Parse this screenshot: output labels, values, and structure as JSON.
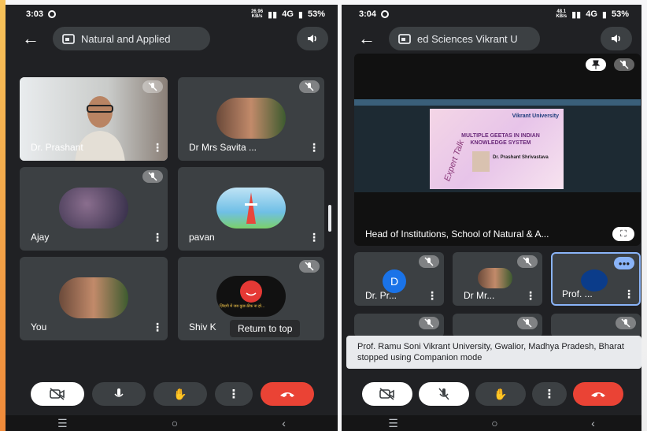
{
  "left": {
    "status": {
      "time": "3:03",
      "net_top": "26.96",
      "net_bottom": "KB/s",
      "signal": "4G",
      "battery": "53%"
    },
    "meeting_title": "Natural and Applied",
    "tiles": [
      {
        "name": "Dr. Prashant"
      },
      {
        "name": "Dr Mrs Savita ..."
      },
      {
        "name": "Ajay"
      },
      {
        "name": "pavan"
      },
      {
        "name": "You"
      },
      {
        "name": "Shiv K"
      }
    ],
    "avatar_caption": "ज़िंदगी में जब कुछ ठीक ना हो...",
    "tooltip": "Return to top"
  },
  "right": {
    "status": {
      "time": "3:04",
      "net_top": "48.1",
      "net_bottom": "KB/s",
      "signal": "4G",
      "battery": "53%"
    },
    "meeting_title": "ed Sciences Vikrant U",
    "presentation": {
      "caption": "Head of Institutions, School of Natural & A...",
      "slide_org": "Vikrant University",
      "slide_title": "MULTIPLE GEETAS IN INDIAN KNOWLEDGE SYSTEM",
      "slide_script": "Expert Talk",
      "slide_speaker": "Dr. Prashant Shrivastava"
    },
    "tiles": [
      {
        "name": "Dr. Pr...",
        "initial": "D"
      },
      {
        "name": "Dr Mr..."
      },
      {
        "name": "Prof. ..."
      }
    ],
    "toast": "Prof. Ramu Soni Vikrant University, Gwalior, Madhya Pradesh, Bharat stopped using Companion mode"
  },
  "colors": {
    "bg": "#202124",
    "tile": "#3c4043",
    "hangup": "#ea4335",
    "accent_blue": "#1a73e8"
  }
}
